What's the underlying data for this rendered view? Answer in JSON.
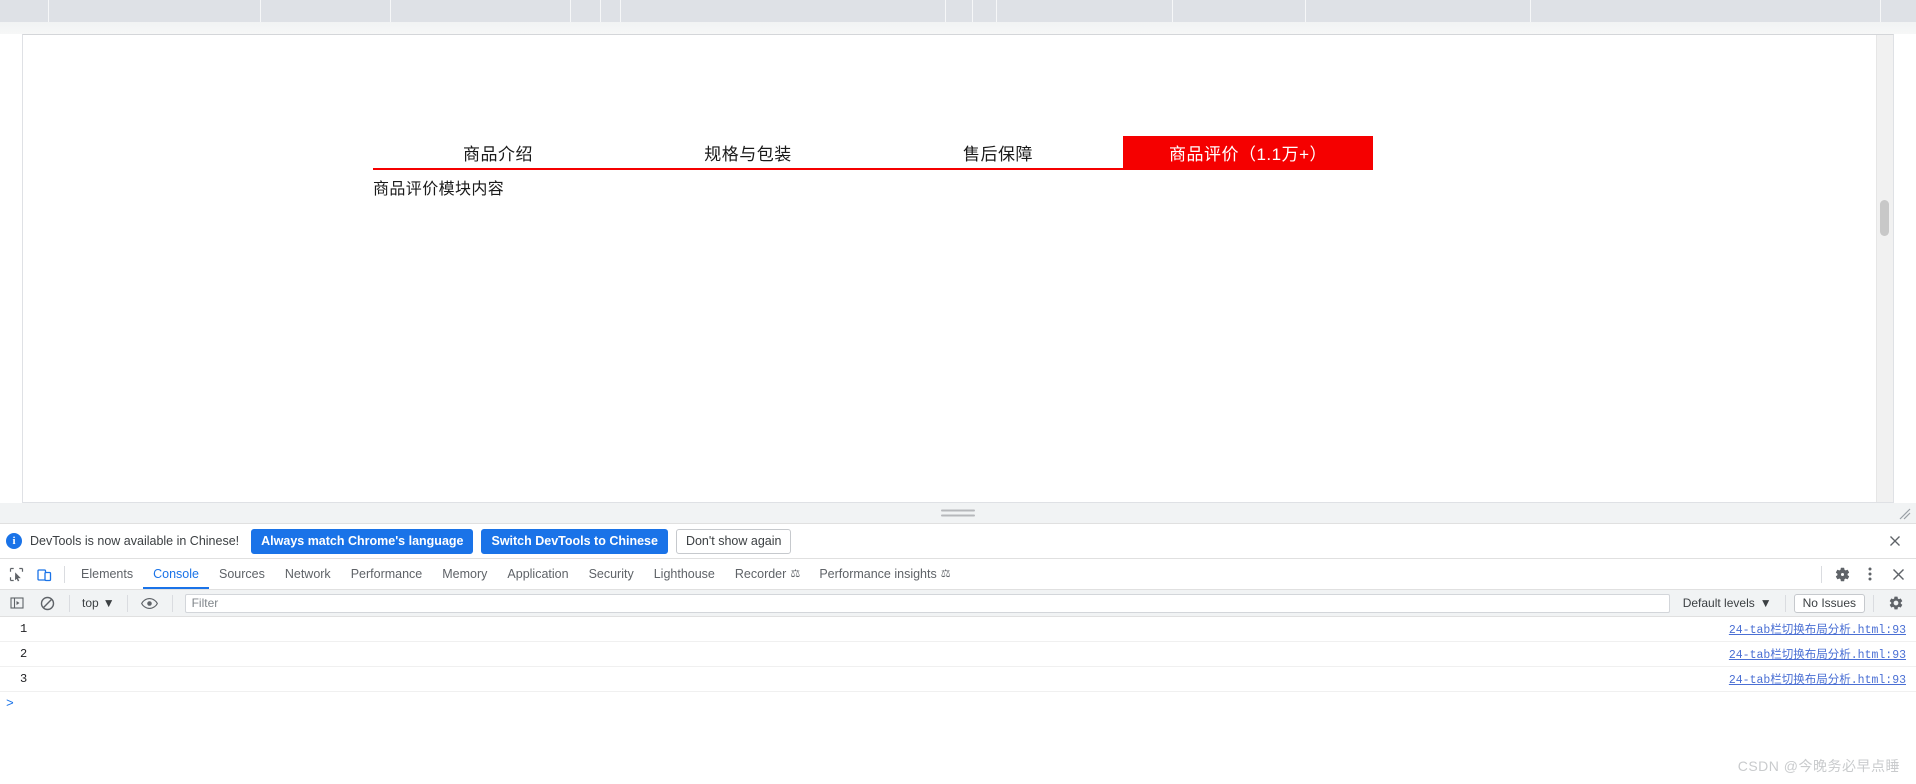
{
  "browser": {
    "bookmark_separators": [
      48,
      260,
      390,
      570,
      600,
      620,
      945,
      972,
      996,
      1172,
      1305,
      1530,
      1880
    ]
  },
  "page": {
    "tabs": [
      {
        "label": "商品介绍",
        "active": false
      },
      {
        "label": "规格与包装",
        "active": false
      },
      {
        "label": "售后保障",
        "active": false
      },
      {
        "label": "商品评价（1.1万+）",
        "active": true
      }
    ],
    "content_text": "商品评价模块内容",
    "accent_color": "#f50000"
  },
  "devtools": {
    "banner": {
      "icon": "info-icon",
      "message": "DevTools is now available in Chinese!",
      "primary_button": "Always match Chrome's language",
      "secondary_button": "Switch DevTools to Chinese",
      "tertiary_button": "Don't show again",
      "close_icon": "close-icon"
    },
    "panel_tabs": [
      {
        "label": "Elements",
        "active": false,
        "experimental": false
      },
      {
        "label": "Console",
        "active": true,
        "experimental": false
      },
      {
        "label": "Sources",
        "active": false,
        "experimental": false
      },
      {
        "label": "Network",
        "active": false,
        "experimental": false
      },
      {
        "label": "Performance",
        "active": false,
        "experimental": false
      },
      {
        "label": "Memory",
        "active": false,
        "experimental": false
      },
      {
        "label": "Application",
        "active": false,
        "experimental": false
      },
      {
        "label": "Security",
        "active": false,
        "experimental": false
      },
      {
        "label": "Lighthouse",
        "active": false,
        "experimental": false
      },
      {
        "label": "Recorder",
        "active": false,
        "experimental": true
      },
      {
        "label": "Performance insights",
        "active": false,
        "experimental": true
      }
    ],
    "console_toolbar": {
      "context": "top",
      "filter_placeholder": "Filter",
      "filter_value": "",
      "levels": "Default levels",
      "issues": "No Issues"
    },
    "console_messages": [
      {
        "text": "1",
        "source": "24-tab栏切换布局分析.html:93"
      },
      {
        "text": "2",
        "source": "24-tab栏切换布局分析.html:93"
      },
      {
        "text": "3",
        "source": "24-tab栏切换布局分析.html:93"
      }
    ],
    "prompt_symbol": ">"
  },
  "watermark": "CSDN @今晚务必早点睡"
}
